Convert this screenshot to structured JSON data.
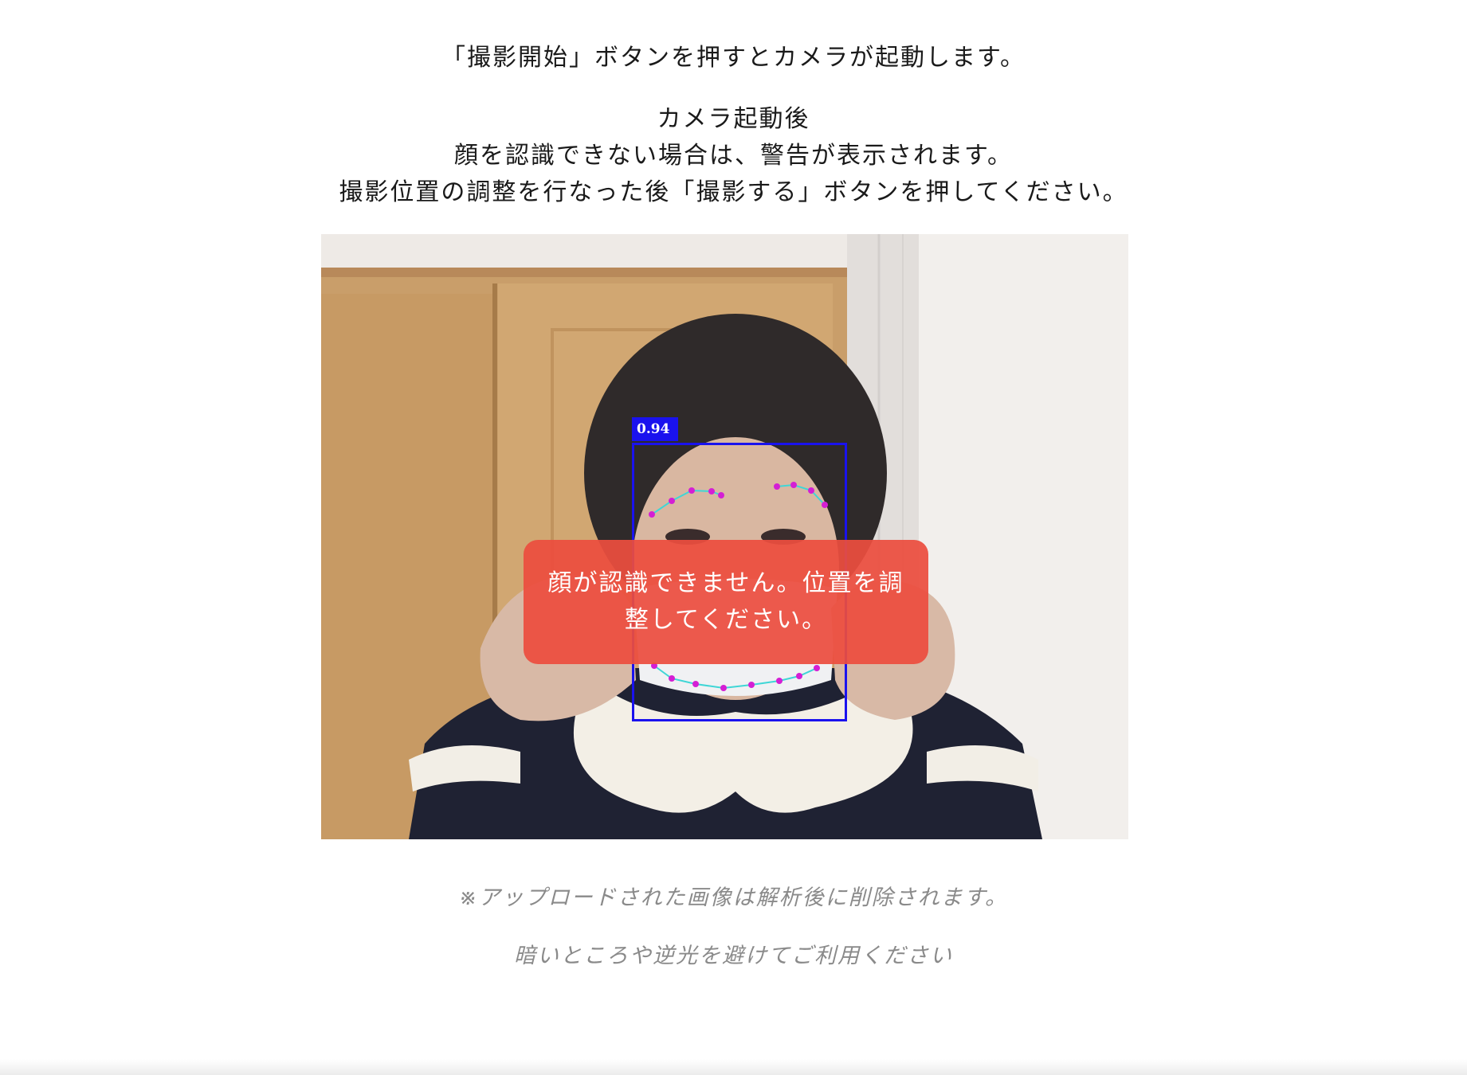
{
  "instructions": {
    "line1": "「撮影開始」ボタンを押すとカメラが起動します。",
    "line2": "カメラ起動後",
    "line3": "顔を認識できない場合は、警告が表示されます。",
    "line4": "撮影位置の調整を行なった後「撮影する」ボタンを押してください。"
  },
  "camera": {
    "detection_score": "0.94",
    "box_color": "#1a12ee",
    "landmark_color": "#d41fd4",
    "contour_color": "#3fd6d6",
    "warning": "顔が認識できません。位置を調整してください。",
    "warning_color": "#ec4e3e"
  },
  "notes": {
    "upload": "※アップロードされた画像は解析後に削除されます。",
    "lighting": "暗いところや逆光を避けてご利用ください"
  }
}
